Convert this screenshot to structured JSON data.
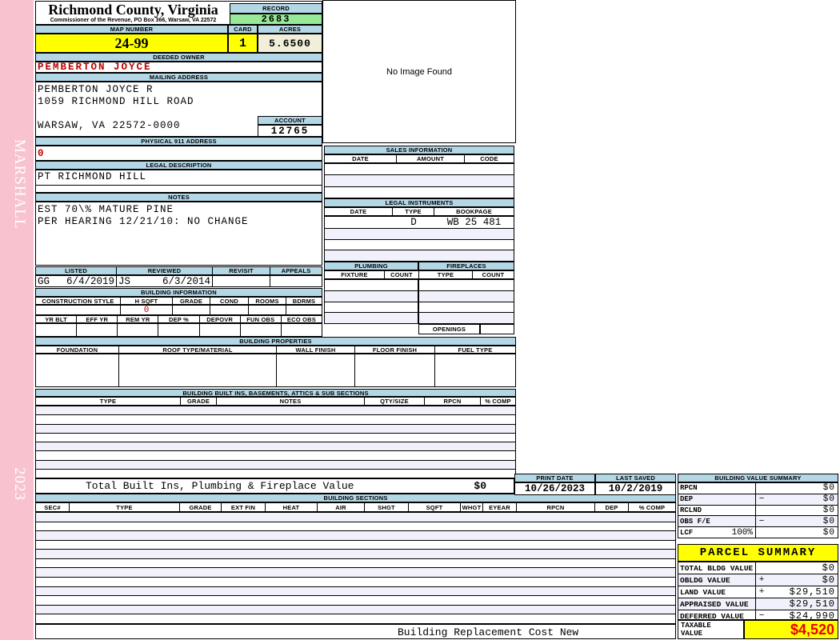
{
  "sidebar": {
    "vendor": "MARSHALL",
    "year": "2023"
  },
  "header": {
    "county": "Richmond County, Virginia",
    "subtitle": "Commissioner of the Revenue, PO Box 366, Warsaw, VA 22572",
    "record_label": "RECORD",
    "record_value": "2683",
    "map_label": "MAP NUMBER",
    "map_value": "24-99",
    "card_label": "CARD",
    "card_value": "1",
    "acres_label": "ACRES",
    "acres_value": "5.6500"
  },
  "owner": {
    "section_label": "DEEDED OWNER",
    "name": "PEMBERTON JOYCE",
    "mailing_label": "MAILING ADDRESS",
    "mailing_lines": [
      "PEMBERTON JOYCE R",
      "1059 RICHMOND HILL ROAD",
      "WARSAW, VA 22572-0000"
    ],
    "account_label": "ACCOUNT",
    "account_value": "12765",
    "physical_label": "PHYSICAL 911 ADDRESS",
    "physical_value": "0"
  },
  "legal_description": {
    "label": "LEGAL DESCRIPTION",
    "value": "PT RICHMOND HILL"
  },
  "notes": {
    "label": "NOTES",
    "lines": [
      "EST 70\\% MATURE PINE",
      "PER HEARING 12/21/10: NO CHANGE"
    ]
  },
  "review": {
    "headers": [
      "LISTED",
      "REVIEWED",
      "REVISIT",
      "APPEALS"
    ],
    "listed_by": "GG",
    "listed_date": "6/4/2019",
    "reviewed_by": "JS",
    "reviewed_date": "6/3/2014"
  },
  "building_information": {
    "label": "BUILDING INFORMATION",
    "row1_headers": [
      "CONSTRUCTION STYLE",
      "H SQFT",
      "GRADE",
      "COND",
      "ROOMS",
      "BDRMS"
    ],
    "h_sqft_value": "0",
    "row2_headers": [
      "YR BLT",
      "EFF YR",
      "REM YR",
      "DEP %",
      "DEPOVR",
      "FUN OBS",
      "ECO OBS"
    ]
  },
  "building_properties": {
    "label": "BUILDING PROPERTIES",
    "headers": [
      "FOUNDATION",
      "ROOF TYPE/MATERIAL",
      "WALL FINISH",
      "FLOOR FINISH",
      "FUEL TYPE"
    ]
  },
  "built_ins": {
    "label": "BUILDING BUILT INS, BASEMENTS, ATTICS & SUB SECTIONS",
    "headers": [
      "TYPE",
      "GRADE",
      "NOTES",
      "QTY/SIZE",
      "RPCN",
      "% COMP"
    ],
    "total_label": "Total Built Ins, Plumbing & Fireplace Value",
    "total_value": "$0"
  },
  "image_panel": {
    "message": "No Image Found"
  },
  "sales_information": {
    "label": "SALES INFORMATION",
    "headers": [
      "DATE",
      "AMOUNT",
      "CODE"
    ]
  },
  "legal_instruments": {
    "label": "LEGAL INSTRUMENTS",
    "headers": [
      "DATE",
      "TYPE",
      "BOOKPAGE"
    ],
    "rows": [
      {
        "date": "",
        "type": "D",
        "book_page": "WB 25 481"
      }
    ]
  },
  "plumbing": {
    "label": "PLUMBING",
    "headers": [
      "FIXTURE",
      "COUNT"
    ]
  },
  "fireplaces": {
    "label": "FIREPLACES",
    "headers": [
      "TYPE",
      "COUNT"
    ],
    "openings_label": "OPENINGS"
  },
  "building_sections": {
    "label": "BUILDING SECTIONS",
    "headers": [
      "SEC#",
      "TYPE",
      "GRADE",
      "EXT FIN",
      "HEAT",
      "AIR",
      "SHGT",
      "SQFT",
      "WHGT",
      "EYEAR",
      "RPCN",
      "DEP",
      "% COMP"
    ],
    "footer_note": "Building Replacement Cost New"
  },
  "print_info": {
    "print_date_label": "PRINT DATE",
    "print_date": "10/26/2023",
    "last_saved_label": "LAST SAVED",
    "last_saved": "10/2/2019"
  },
  "building_value_summary": {
    "label": "BUILDING VALUE SUMMARY",
    "rows": [
      {
        "label": "RPCN",
        "op": "",
        "value": "$0"
      },
      {
        "label": "DEP",
        "op": "−",
        "value": "$0"
      },
      {
        "label": "RCLND",
        "op": "",
        "value": "$0"
      },
      {
        "label": "OBS F/E",
        "op": "−",
        "value": "$0"
      },
      {
        "label": "LCF",
        "pct": "100%",
        "op": "",
        "value": "$0"
      }
    ]
  },
  "parcel_summary": {
    "label": "PARCEL SUMMARY",
    "rows": [
      {
        "label": "TOTAL BLDG VALUE",
        "op": "",
        "value": "$0"
      },
      {
        "label": "OBLDG VALUE",
        "op": "+",
        "value": "$0"
      },
      {
        "label": "LAND VALUE",
        "op": "+",
        "value": "$29,510"
      },
      {
        "label": "APPRAISED VALUE",
        "op": "",
        "value": "$29,510"
      },
      {
        "label": "DEFERRED VALUE",
        "op": "−",
        "value": "$24,990"
      }
    ],
    "taxable_label_line1": "TAXABLE",
    "taxable_label_line2": "VALUE",
    "taxable_value": "$4,520"
  },
  "colors": {
    "accent_blue": "#b4d7e6",
    "highlight_yellow": "#ffff00",
    "record_green": "#97e897",
    "acres_cream": "#f1efda",
    "alert_red": "#c00000",
    "sidebar_pink": "#f8c3cf",
    "stripe": "#f0f1fa"
  }
}
